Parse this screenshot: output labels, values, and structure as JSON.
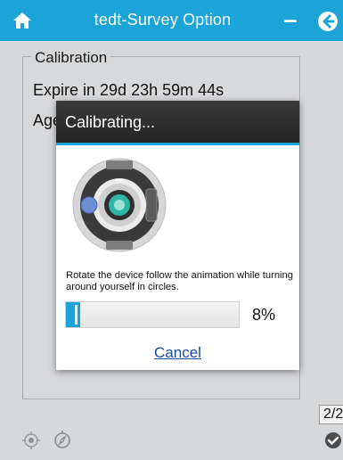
{
  "header": {
    "title": "tedt-Survey Option",
    "minus_label": "–",
    "accent_color": "#1aa4d8"
  },
  "calibration": {
    "group_label": "Calibration",
    "expire_text": "Expire in 29d 23h 59m 44s",
    "age_text": "Age"
  },
  "pager": {
    "text": "2/2"
  },
  "dialog": {
    "title": "Calibrating...",
    "instruction": "Rotate the device follow the animation while turning around yourself in circles.",
    "progress_percent": 8,
    "progress_label": "8%",
    "cancel_label": "Cancel"
  },
  "icons": {
    "home": "home-icon",
    "back": "back-arrow-icon",
    "bottom_left": "gps-target-icon",
    "bottom_second": "compass-icon",
    "bottom_right": "check-circle-icon"
  }
}
